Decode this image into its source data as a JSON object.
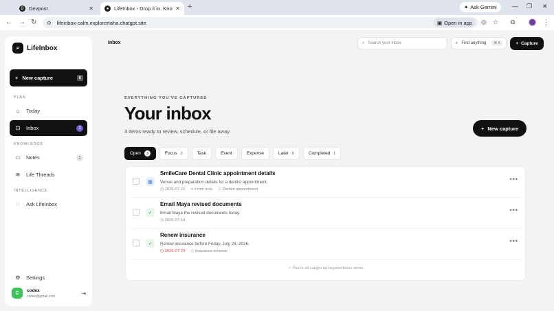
{
  "browser": {
    "tabs": [
      {
        "title": "Devpost",
        "favicon": "devpost-icon"
      },
      {
        "title": "LifeInbox - Drop it in. Know wh",
        "favicon": "lifeinbox-icon"
      }
    ],
    "ask_gemini": "Ask Gemini",
    "url": "lifeinbox-calm.explorertaha.chatgpt.site",
    "open_in_app": "Open in app"
  },
  "sidebar": {
    "app_name": "LifeInbox",
    "new_capture": "New capture",
    "new_capture_kbd": "K",
    "sections": {
      "plan": "PLAN",
      "knowledge": "KNOWLEDGE",
      "intelligence": "INTELLIGENCE"
    },
    "items": [
      {
        "label": "Today",
        "icon": "sun-icon"
      },
      {
        "label": "Inbox",
        "icon": "inbox-icon",
        "badge": "3"
      },
      {
        "label": "Notes",
        "icon": "note-icon",
        "badge": "1"
      },
      {
        "label": "Life Threads",
        "icon": "layers-icon"
      },
      {
        "label": "Ask LifeInbox",
        "icon": "chat-icon"
      },
      {
        "label": "Settings",
        "icon": "gear-icon"
      }
    ],
    "user": {
      "initial": "C",
      "name": "codex",
      "email": "codex@gmail.com"
    }
  },
  "header": {
    "breadcrumb": "Inbox",
    "search_placeholder": "Search your inbox",
    "find_label": "Find anything",
    "find_kbd": "⌘ K",
    "capture_label": "Capture"
  },
  "hero": {
    "eyebrow": "EVERYTHING YOU'VE CAPTURED",
    "title": "Your inbox",
    "subtitle": "3 items ready to review, schedule, or file away.",
    "new_capture": "New capture"
  },
  "filters": [
    {
      "label": "Open",
      "count": "3"
    },
    {
      "label": "Focus",
      "count": "2"
    },
    {
      "label": "Task",
      "count": ""
    },
    {
      "label": "Event",
      "count": ""
    },
    {
      "label": "Expense",
      "count": ""
    },
    {
      "label": "Later",
      "count": "0"
    },
    {
      "label": "Completed",
      "count": "1"
    }
  ],
  "items": [
    {
      "title": "SmileCare Dental Clinic appointment details",
      "description": "Venue and preparation details for a dentist appointment.",
      "date": "2026-07-22",
      "source": "From note",
      "tag": "Dentist appointment",
      "type": "event"
    },
    {
      "title": "Email Maya revised documents",
      "description": "Email Maya the revised documents today.",
      "date": "2026-07-19",
      "type": "task"
    },
    {
      "title": "Renew insurance",
      "description": "Renew insurance before Friday, July 24, 2026.",
      "date": "2026-07-24",
      "tag": "Insurance renewal",
      "type": "task",
      "date_color": "#d24a3a"
    }
  ],
  "list_footer": "You're all caught up beyond these items."
}
